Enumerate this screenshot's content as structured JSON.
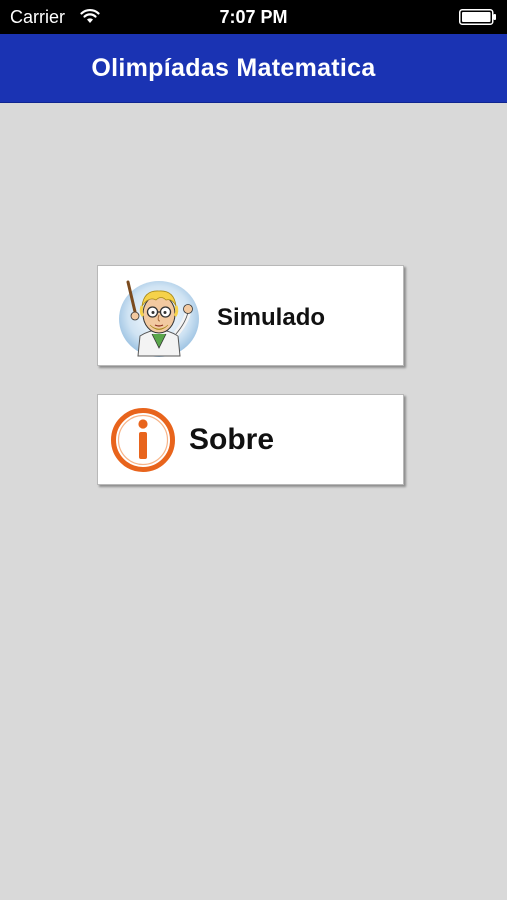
{
  "status_bar": {
    "carrier": "Carrier",
    "time": "7:07 PM",
    "wifi_icon": "wifi-icon",
    "battery_icon": "battery-full-icon"
  },
  "nav_bar": {
    "title": "Olimpíadas Matematica",
    "background_color": "#1a33b3"
  },
  "menu": {
    "items": [
      {
        "label": "Simulado",
        "icon": "professor-icon"
      },
      {
        "label": "Sobre",
        "icon": "info-icon",
        "icon_color": "#e8641c"
      }
    ]
  },
  "colors": {
    "page_background": "#d9d9d9",
    "button_background": "#ffffff"
  }
}
